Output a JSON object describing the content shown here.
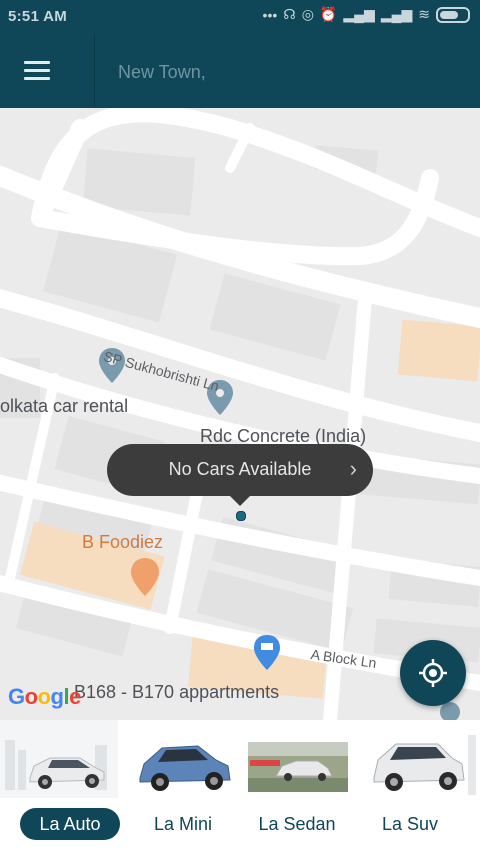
{
  "status_bar": {
    "time": "5:51 AM",
    "icons": [
      "more-dots-icon",
      "headphones-icon",
      "location-icon",
      "alarm-icon",
      "signal-icon",
      "signal-icon",
      "wifi-icon",
      "battery-icon"
    ]
  },
  "header": {
    "location": "New Town,"
  },
  "map": {
    "labels": {
      "street1": "SP Sukhobrishti Ln",
      "place1": "olkata car rental",
      "place2": "Rdc Concrete (India)",
      "place3": "B Foodiez",
      "street2": "A Block Ln",
      "place4": "B168 - B170 appartments"
    },
    "google_letters": [
      "G",
      "o",
      "o",
      "g",
      "l",
      "e"
    ],
    "callout": "No Cars Available",
    "callout_chevron": "›",
    "colors": {
      "primary": "#0f4658",
      "map_bg": "#ebebeb",
      "road": "#ffffff",
      "pin": "#7a9aae",
      "food_pin": "#f0a06a",
      "shop_pin": "#3f8ce0"
    }
  },
  "car_types": [
    {
      "label": "La Auto",
      "icon": "hatchback-car-icon",
      "active": true
    },
    {
      "label": "La Mini",
      "icon": "mini-car-icon",
      "active": false
    },
    {
      "label": "La Sedan",
      "icon": "sedan-car-icon",
      "active": false
    },
    {
      "label": "La Suv",
      "icon": "suv-car-icon",
      "active": false
    }
  ]
}
